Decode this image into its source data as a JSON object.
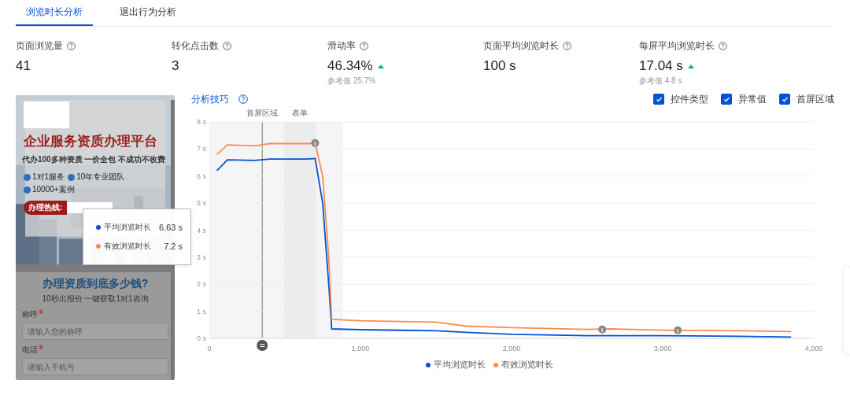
{
  "tabs": [
    {
      "label": "浏览时长分析",
      "selected": true
    },
    {
      "label": "退出行为分析",
      "selected": false
    }
  ],
  "metrics": [
    {
      "label": "页面浏览量",
      "value": "41"
    },
    {
      "label": "转化点击数",
      "value": "3"
    },
    {
      "label": "滑动率",
      "value": "46.34%",
      "rising": true,
      "reference": "参考值 25.7%"
    },
    {
      "label": "页面平均浏览时长",
      "value": "100 s"
    },
    {
      "label": "每屏平均浏览时长",
      "value": "17.04 s",
      "rising": true,
      "reference": "参考值 4.8 s"
    }
  ],
  "preview": {
    "headline": "企业服务资质办理平台",
    "subtitle": "代办100多种资质 一价全包 不成功不收费",
    "badges": [
      "1对1服务",
      "10年专业团队",
      "10000+案例"
    ],
    "hotline_label": "办理热线:",
    "form_title": "办理资质到底多少钱?",
    "form_subtitle": "10秒出报价 一键获取1对1咨询",
    "fields": [
      {
        "label": "称呼",
        "required": true,
        "placeholder": "请输入您的称呼"
      },
      {
        "label": "电话",
        "required": true,
        "placeholder": "请输入手机号"
      }
    ]
  },
  "tooltip": {
    "items": [
      {
        "name": "平均浏览时长",
        "value": "6.63 s",
        "color": "#0052d9"
      },
      {
        "name": "有效浏览时长",
        "value": "7.2 s",
        "color": "#ff8a50"
      }
    ]
  },
  "chart_panel": {
    "tips_link": "分析技巧",
    "options": [
      {
        "label": "控件类型",
        "checked": true
      },
      {
        "label": "异常值",
        "checked": true
      },
      {
        "label": "首屏区域",
        "checked": true
      }
    ],
    "chart_data": {
      "type": "line",
      "x": [
        50,
        120,
        300,
        400,
        650,
        700,
        750,
        790,
        810,
        1000,
        1500,
        1700,
        2000,
        2500,
        2650,
        3000,
        3500,
        3850
      ],
      "series": [
        {
          "name": "平均浏览时长",
          "color": "#0052d9",
          "values": [
            6.2,
            6.6,
            6.58,
            6.63,
            6.63,
            6.65,
            5.0,
            2.0,
            0.35,
            0.32,
            0.28,
            0.22,
            0.15,
            0.1,
            0.1,
            0.1,
            0.08,
            0.05
          ]
        },
        {
          "name": "有效浏览时长",
          "color": "#ff8a50",
          "values": [
            6.8,
            7.15,
            7.12,
            7.2,
            7.2,
            7.22,
            6.0,
            3.0,
            0.7,
            0.65,
            0.6,
            0.45,
            0.4,
            0.33,
            0.35,
            0.3,
            0.28,
            0.25
          ]
        }
      ],
      "xlim": [
        0,
        4000
      ],
      "ylim": [
        0,
        8
      ],
      "xticks": [
        {
          "value": 0,
          "label": "0"
        },
        {
          "value": 1000,
          "label": "1,000"
        },
        {
          "value": 2000,
          "label": "2,000"
        },
        {
          "value": 3000,
          "label": "3,000"
        },
        {
          "value": 4000,
          "label": "4,000"
        }
      ],
      "yticks": [
        {
          "value": 0,
          "label": "0 s"
        },
        {
          "value": 1,
          "label": "1 s"
        },
        {
          "value": 2,
          "label": "2 s"
        },
        {
          "value": 3,
          "label": "3 s"
        },
        {
          "value": 4,
          "label": "4 s"
        },
        {
          "value": 5,
          "label": "5 s"
        },
        {
          "value": 6,
          "label": "6 s"
        },
        {
          "value": 7,
          "label": "7 s"
        },
        {
          "value": 8,
          "label": "8 s"
        }
      ],
      "grid": true,
      "bands": [
        {
          "axis": "x",
          "from": 0,
          "to": 885
        },
        {
          "axis": "x",
          "from": 495,
          "to": 705,
          "label": "表单"
        }
      ],
      "ref_lines": [
        {
          "axis": "x",
          "value": 350,
          "label": "首屏区域"
        }
      ],
      "annotations": [
        {
          "x": 700,
          "y": 7.22,
          "text": "i"
        },
        {
          "x": 2600,
          "y": 0.33,
          "text": "i"
        },
        {
          "x": 3100,
          "y": 0.3,
          "text": "i"
        }
      ]
    }
  }
}
